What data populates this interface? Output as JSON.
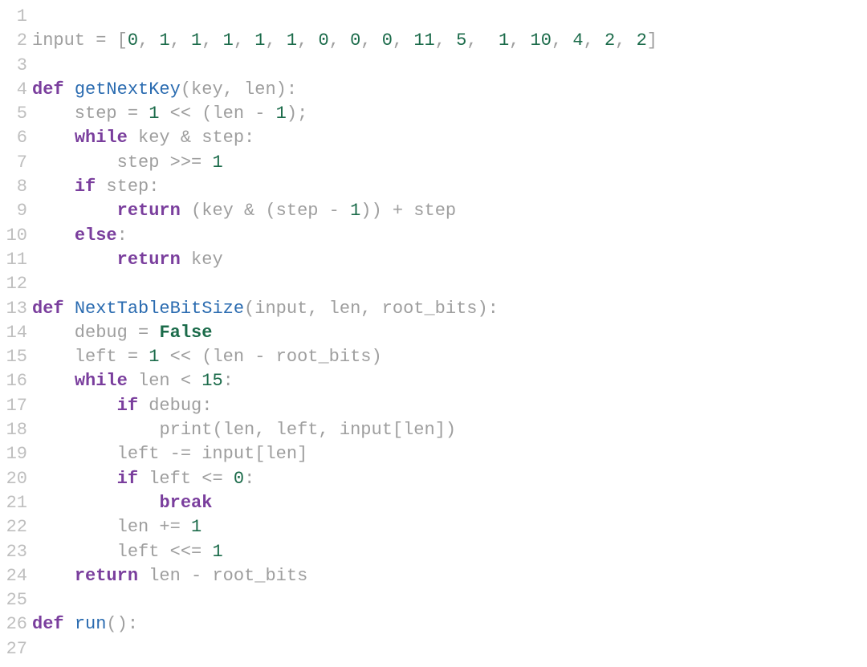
{
  "code": {
    "lines": [
      {
        "num": "1",
        "tokens": []
      },
      {
        "num": "2",
        "tokens": [
          {
            "t": "input = [",
            "c": "tk-id"
          },
          {
            "t": "0",
            "c": "tk-num"
          },
          {
            "t": ", ",
            "c": "tk-id"
          },
          {
            "t": "1",
            "c": "tk-num"
          },
          {
            "t": ", ",
            "c": "tk-id"
          },
          {
            "t": "1",
            "c": "tk-num"
          },
          {
            "t": ", ",
            "c": "tk-id"
          },
          {
            "t": "1",
            "c": "tk-num"
          },
          {
            "t": ", ",
            "c": "tk-id"
          },
          {
            "t": "1",
            "c": "tk-num"
          },
          {
            "t": ", ",
            "c": "tk-id"
          },
          {
            "t": "1",
            "c": "tk-num"
          },
          {
            "t": ", ",
            "c": "tk-id"
          },
          {
            "t": "0",
            "c": "tk-num"
          },
          {
            "t": ", ",
            "c": "tk-id"
          },
          {
            "t": "0",
            "c": "tk-num"
          },
          {
            "t": ", ",
            "c": "tk-id"
          },
          {
            "t": "0",
            "c": "tk-num"
          },
          {
            "t": ", ",
            "c": "tk-id"
          },
          {
            "t": "11",
            "c": "tk-num"
          },
          {
            "t": ", ",
            "c": "tk-id"
          },
          {
            "t": "5",
            "c": "tk-num"
          },
          {
            "t": ",  ",
            "c": "tk-id"
          },
          {
            "t": "1",
            "c": "tk-num"
          },
          {
            "t": ", ",
            "c": "tk-id"
          },
          {
            "t": "10",
            "c": "tk-num"
          },
          {
            "t": ", ",
            "c": "tk-id"
          },
          {
            "t": "4",
            "c": "tk-num"
          },
          {
            "t": ", ",
            "c": "tk-id"
          },
          {
            "t": "2",
            "c": "tk-num"
          },
          {
            "t": ", ",
            "c": "tk-id"
          },
          {
            "t": "2",
            "c": "tk-num"
          },
          {
            "t": "]",
            "c": "tk-id"
          }
        ]
      },
      {
        "num": "3",
        "tokens": []
      },
      {
        "num": "4",
        "tokens": [
          {
            "t": "def ",
            "c": "tk-kw"
          },
          {
            "t": "getNextKey",
            "c": "tk-fn"
          },
          {
            "t": "(key, len):",
            "c": "tk-id"
          }
        ]
      },
      {
        "num": "5",
        "tokens": [
          {
            "t": "    step = ",
            "c": "tk-id"
          },
          {
            "t": "1",
            "c": "tk-num"
          },
          {
            "t": " << (len - ",
            "c": "tk-id"
          },
          {
            "t": "1",
            "c": "tk-num"
          },
          {
            "t": ");",
            "c": "tk-id"
          }
        ]
      },
      {
        "num": "6",
        "tokens": [
          {
            "t": "    ",
            "c": "tk-id"
          },
          {
            "t": "while ",
            "c": "tk-kw"
          },
          {
            "t": "key & step:",
            "c": "tk-id"
          }
        ]
      },
      {
        "num": "7",
        "tokens": [
          {
            "t": "        step >>= ",
            "c": "tk-id"
          },
          {
            "t": "1",
            "c": "tk-num"
          }
        ]
      },
      {
        "num": "8",
        "tokens": [
          {
            "t": "    ",
            "c": "tk-id"
          },
          {
            "t": "if ",
            "c": "tk-kw"
          },
          {
            "t": "step:",
            "c": "tk-id"
          }
        ]
      },
      {
        "num": "9",
        "tokens": [
          {
            "t": "        ",
            "c": "tk-id"
          },
          {
            "t": "return ",
            "c": "tk-kw"
          },
          {
            "t": "(key & (step - ",
            "c": "tk-id"
          },
          {
            "t": "1",
            "c": "tk-num"
          },
          {
            "t": ")) + step",
            "c": "tk-id"
          }
        ]
      },
      {
        "num": "10",
        "tokens": [
          {
            "t": "    ",
            "c": "tk-id"
          },
          {
            "t": "else",
            "c": "tk-kw"
          },
          {
            "t": ":",
            "c": "tk-id"
          }
        ]
      },
      {
        "num": "11",
        "tokens": [
          {
            "t": "        ",
            "c": "tk-id"
          },
          {
            "t": "return ",
            "c": "tk-kw"
          },
          {
            "t": "key",
            "c": "tk-id"
          }
        ]
      },
      {
        "num": "12",
        "tokens": []
      },
      {
        "num": "13",
        "tokens": [
          {
            "t": "def ",
            "c": "tk-kw"
          },
          {
            "t": "NextTableBitSize",
            "c": "tk-fn"
          },
          {
            "t": "(input, len, root_bits):",
            "c": "tk-id"
          }
        ]
      },
      {
        "num": "14",
        "tokens": [
          {
            "t": "    debug = ",
            "c": "tk-id"
          },
          {
            "t": "False",
            "c": "tk-bool"
          }
        ]
      },
      {
        "num": "15",
        "tokens": [
          {
            "t": "    left = ",
            "c": "tk-id"
          },
          {
            "t": "1",
            "c": "tk-num"
          },
          {
            "t": " << (len - root_bits)",
            "c": "tk-id"
          }
        ]
      },
      {
        "num": "16",
        "tokens": [
          {
            "t": "    ",
            "c": "tk-id"
          },
          {
            "t": "while ",
            "c": "tk-kw"
          },
          {
            "t": "len < ",
            "c": "tk-id"
          },
          {
            "t": "15",
            "c": "tk-num"
          },
          {
            "t": ":",
            "c": "tk-id"
          }
        ]
      },
      {
        "num": "17",
        "tokens": [
          {
            "t": "        ",
            "c": "tk-id"
          },
          {
            "t": "if ",
            "c": "tk-kw"
          },
          {
            "t": "debug:",
            "c": "tk-id"
          }
        ]
      },
      {
        "num": "18",
        "tokens": [
          {
            "t": "            ",
            "c": "tk-id"
          },
          {
            "t": "print",
            "c": "tk-call"
          },
          {
            "t": "(len, left, input[len])",
            "c": "tk-id"
          }
        ]
      },
      {
        "num": "19",
        "tokens": [
          {
            "t": "        left -= input[len]",
            "c": "tk-id"
          }
        ]
      },
      {
        "num": "20",
        "tokens": [
          {
            "t": "        ",
            "c": "tk-id"
          },
          {
            "t": "if ",
            "c": "tk-kw"
          },
          {
            "t": "left <= ",
            "c": "tk-id"
          },
          {
            "t": "0",
            "c": "tk-num"
          },
          {
            "t": ":",
            "c": "tk-id"
          }
        ]
      },
      {
        "num": "21",
        "tokens": [
          {
            "t": "            ",
            "c": "tk-id"
          },
          {
            "t": "break",
            "c": "tk-kw"
          }
        ]
      },
      {
        "num": "22",
        "tokens": [
          {
            "t": "        len += ",
            "c": "tk-id"
          },
          {
            "t": "1",
            "c": "tk-num"
          }
        ]
      },
      {
        "num": "23",
        "tokens": [
          {
            "t": "        left <<= ",
            "c": "tk-id"
          },
          {
            "t": "1",
            "c": "tk-num"
          }
        ]
      },
      {
        "num": "24",
        "tokens": [
          {
            "t": "    ",
            "c": "tk-id"
          },
          {
            "t": "return ",
            "c": "tk-kw"
          },
          {
            "t": "len - root_bits",
            "c": "tk-id"
          }
        ]
      },
      {
        "num": "25",
        "tokens": []
      },
      {
        "num": "26",
        "tokens": [
          {
            "t": "def ",
            "c": "tk-kw"
          },
          {
            "t": "run",
            "c": "tk-fn"
          },
          {
            "t": "():",
            "c": "tk-id"
          }
        ]
      },
      {
        "num": "27",
        "tokens": []
      }
    ]
  }
}
